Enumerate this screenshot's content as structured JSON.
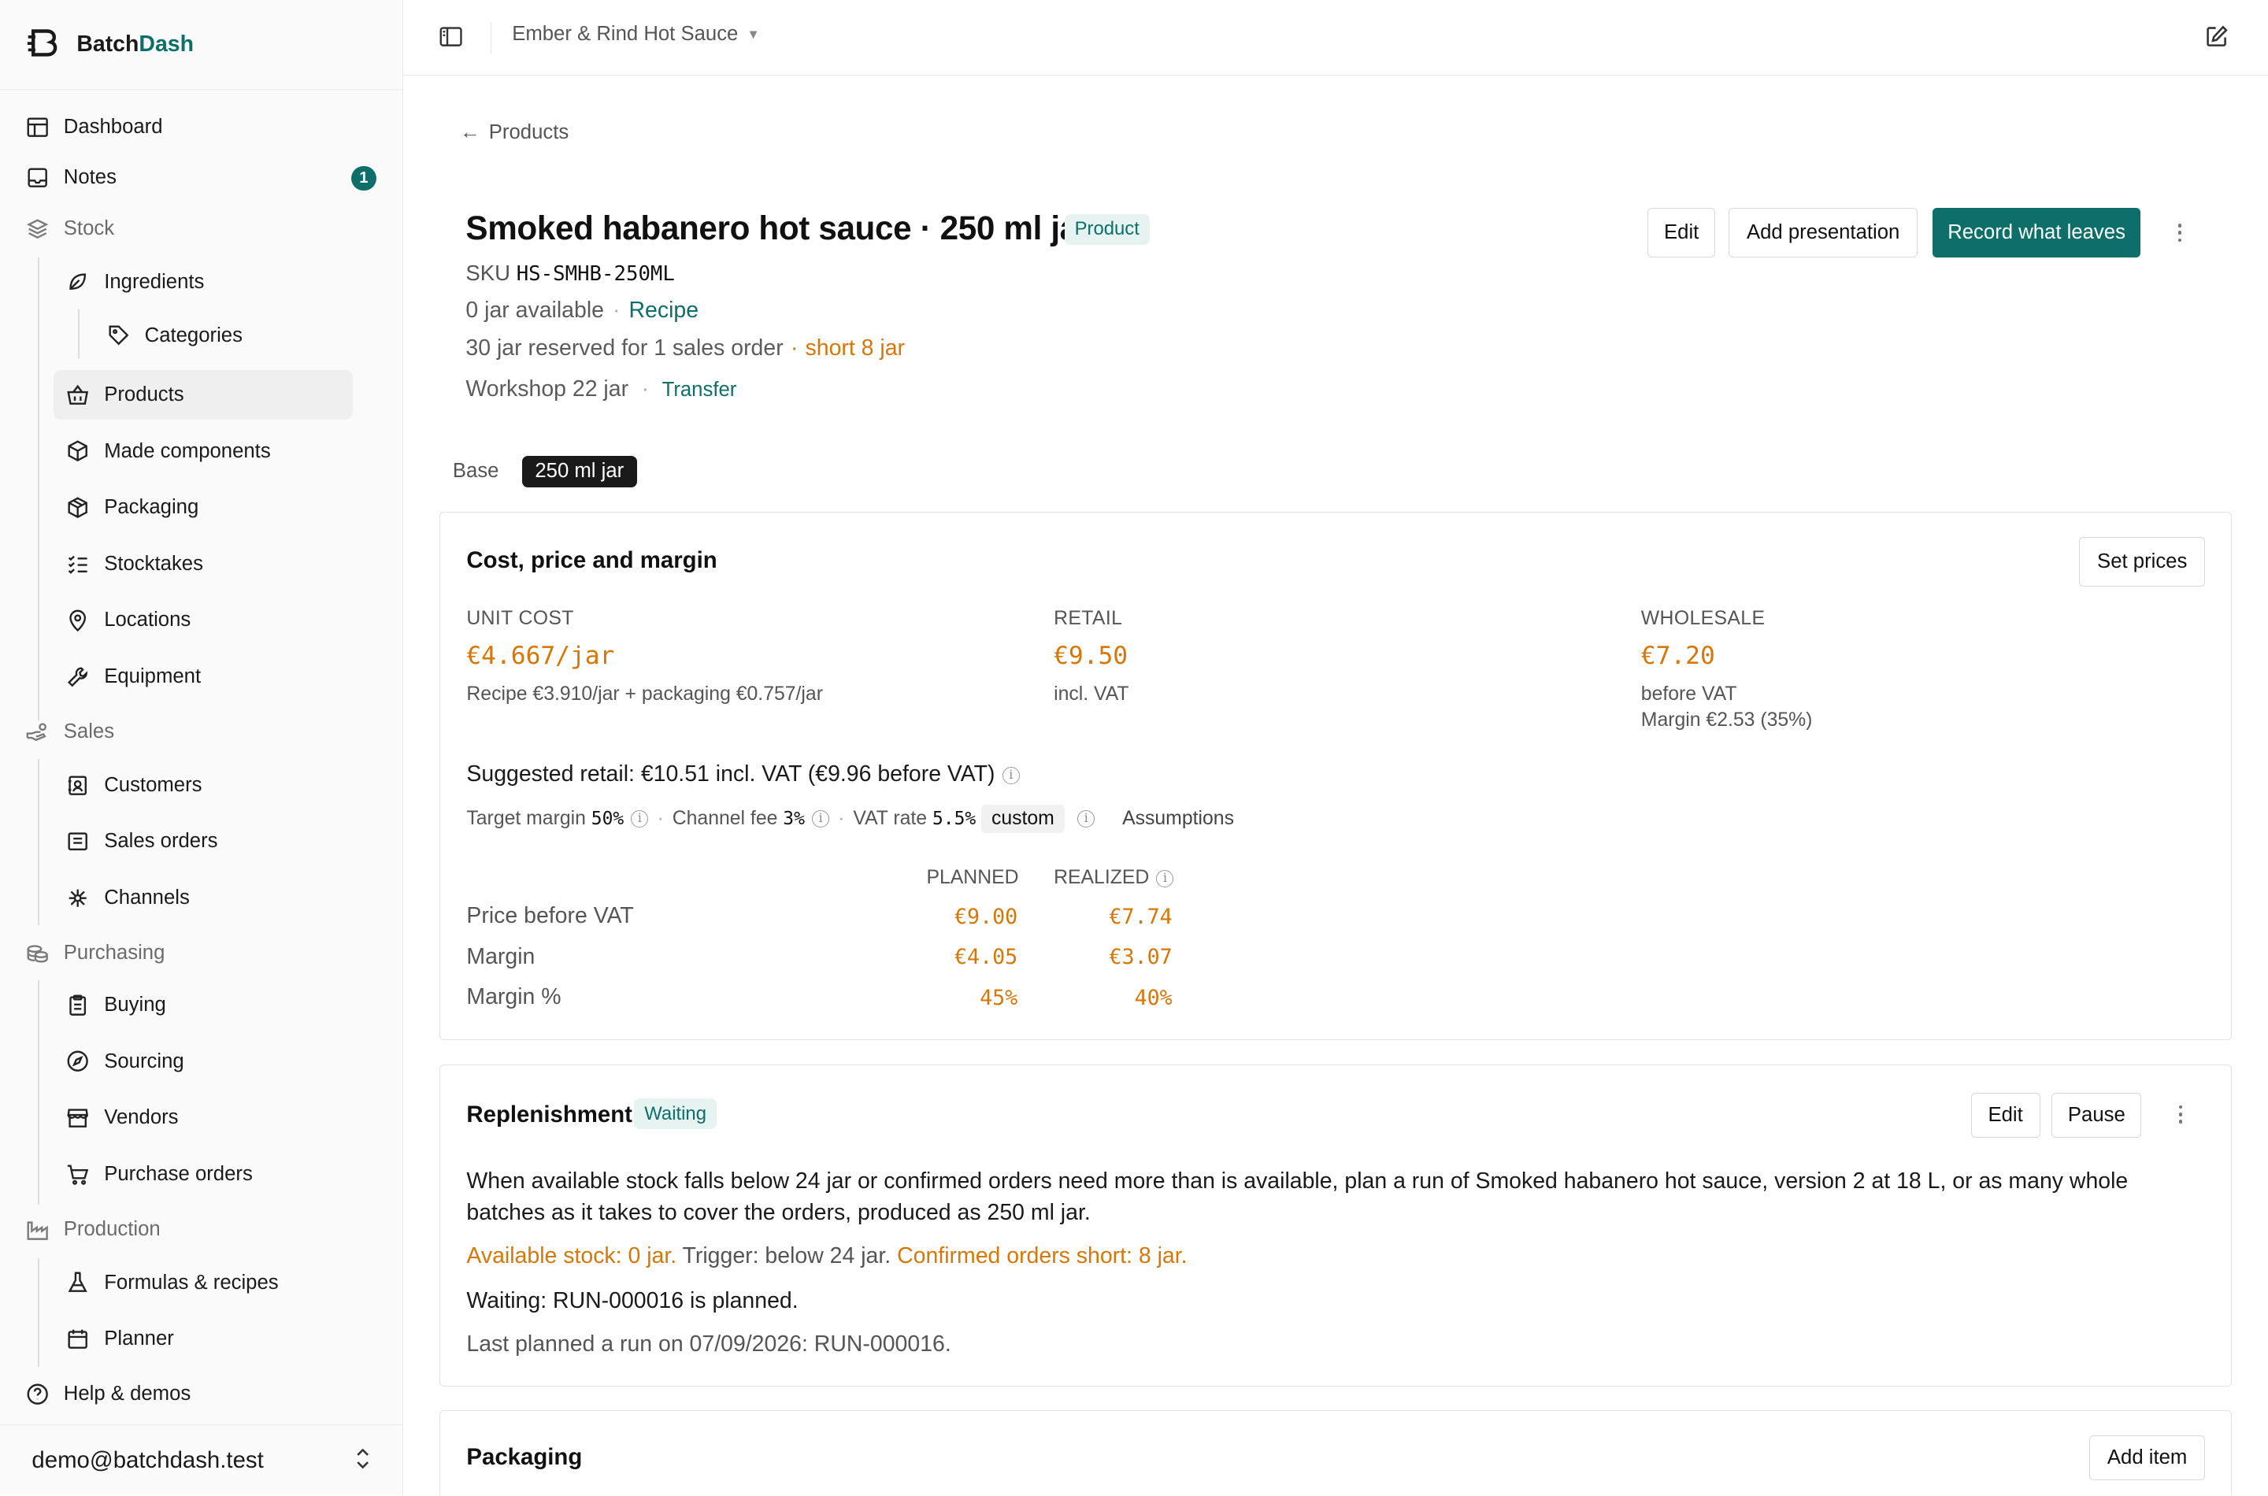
{
  "app": {
    "brand_pre": "Batch",
    "brand_post": "Dash"
  },
  "sidebar": {
    "items": [
      {
        "label": "Dashboard"
      },
      {
        "label": "Notes",
        "badge": "1"
      },
      {
        "label": "Stock"
      },
      {
        "label": "Ingredients"
      },
      {
        "label": "Categories"
      },
      {
        "label": "Products"
      },
      {
        "label": "Made components"
      },
      {
        "label": "Packaging"
      },
      {
        "label": "Stocktakes"
      },
      {
        "label": "Locations"
      },
      {
        "label": "Equipment"
      },
      {
        "label": "Sales"
      },
      {
        "label": "Customers"
      },
      {
        "label": "Sales orders"
      },
      {
        "label": "Channels"
      },
      {
        "label": "Purchasing"
      },
      {
        "label": "Buying"
      },
      {
        "label": "Sourcing"
      },
      {
        "label": "Vendors"
      },
      {
        "label": "Purchase orders"
      },
      {
        "label": "Production"
      },
      {
        "label": "Formulas & recipes"
      },
      {
        "label": "Planner"
      },
      {
        "label": "Help & demos"
      }
    ],
    "user_email": "demo@batchdash.test"
  },
  "topbar": {
    "org": "Ember & Rind Hot Sauce"
  },
  "breadcrumb": {
    "back_label": "Products"
  },
  "product": {
    "title": "Smoked habanero hot sauce · 250 ml jar",
    "tag": "Product",
    "sku_label": "SKU",
    "sku": "HS-SMHB-250ML",
    "available": "0 jar available",
    "recipe_link": "Recipe",
    "reserved": "30 jar reserved for 1 sales order",
    "short": "short 8 jar",
    "workshop": "Workshop 22 jar",
    "transfer_link": "Transfer"
  },
  "actions": {
    "edit": "Edit",
    "add_presentation": "Add presentation",
    "record": "Record what leaves"
  },
  "tabs": {
    "base": "Base",
    "active": "250 ml jar"
  },
  "cost_card": {
    "title": "Cost, price and margin",
    "set_prices": "Set prices",
    "unit_cost_label": "UNIT COST",
    "unit_cost": "€4.667/jar",
    "unit_cost_sub": "Recipe €3.910/jar + packaging €0.757/jar",
    "retail_label": "RETAIL",
    "retail": "€9.50",
    "retail_sub": "incl. VAT",
    "wholesale_label": "WHOLESALE",
    "wholesale": "€7.20",
    "wholesale_sub1": "before VAT",
    "wholesale_sub2": "Margin €2.53 (35%)",
    "suggested": "Suggested retail: €10.51 incl. VAT (€9.96 before VAT)",
    "target_margin_label": "Target margin",
    "target_margin": "50%",
    "channel_fee_label": "Channel fee",
    "channel_fee": "3%",
    "vat_label": "VAT rate",
    "vat": "5.5%",
    "vat_mode": "custom",
    "assumptions": "Assumptions",
    "col_planned": "PLANNED",
    "col_realized": "REALIZED",
    "rows": [
      {
        "label": "Price before VAT",
        "planned": "€9.00",
        "realized": "€7.74"
      },
      {
        "label": "Margin",
        "planned": "€4.05",
        "realized": "€3.07"
      },
      {
        "label": "Margin %",
        "planned": "45%",
        "realized": "40%"
      }
    ]
  },
  "replenishment": {
    "title": "Replenishment",
    "status": "Waiting",
    "edit": "Edit",
    "pause": "Pause",
    "description": "When available stock falls below 24 jar or confirmed orders need more than is available, plan a run of Smoked habanero hot sauce, version 2 at 18 L, or as many whole batches as it takes to cover the orders, produced as 250 ml jar.",
    "available_stock": "Available stock: 0 jar.",
    "trigger": " Trigger: below 24 jar. ",
    "confirmed_short": "Confirmed orders short: 8 jar.",
    "waiting": "Waiting: RUN-000016 is planned.",
    "last_planned": "Last planned a run on 07/09/2026: RUN-000016."
  },
  "packaging_card": {
    "title": "Packaging",
    "add_item": "Add item"
  },
  "colors": {
    "accent": "#0d6e6a",
    "warning": "#d97706"
  }
}
